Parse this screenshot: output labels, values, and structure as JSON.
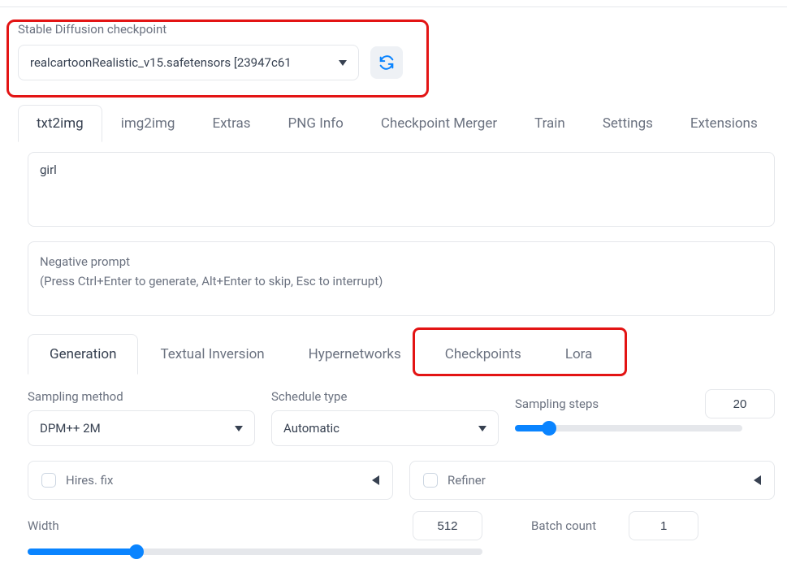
{
  "checkpoint": {
    "label": "Stable Diffusion checkpoint",
    "value": "realcartoonRealistic_v15.safetensors [23947c61"
  },
  "tabs": [
    "txt2img",
    "img2img",
    "Extras",
    "PNG Info",
    "Checkpoint Merger",
    "Train",
    "Settings",
    "Extensions"
  ],
  "active_tab": "txt2img",
  "prompt": "girl",
  "neg_placeholder_line1": "Negative prompt",
  "neg_placeholder_line2": "(Press Ctrl+Enter to generate, Alt+Enter to skip, Esc to interrupt)",
  "sub_tabs": [
    "Generation",
    "Textual Inversion",
    "Hypernetworks",
    "Checkpoints",
    "Lora"
  ],
  "active_sub_tab": "Generation",
  "sampling": {
    "method_label": "Sampling method",
    "method_value": "DPM++ 2M",
    "schedule_label": "Schedule type",
    "schedule_value": "Automatic",
    "steps_label": "Sampling steps",
    "steps_value": "20"
  },
  "hires_label": "Hires. fix",
  "refiner_label": "Refiner",
  "width_label": "Width",
  "width_value": "512",
  "batch_label": "Batch count",
  "batch_value": "1"
}
